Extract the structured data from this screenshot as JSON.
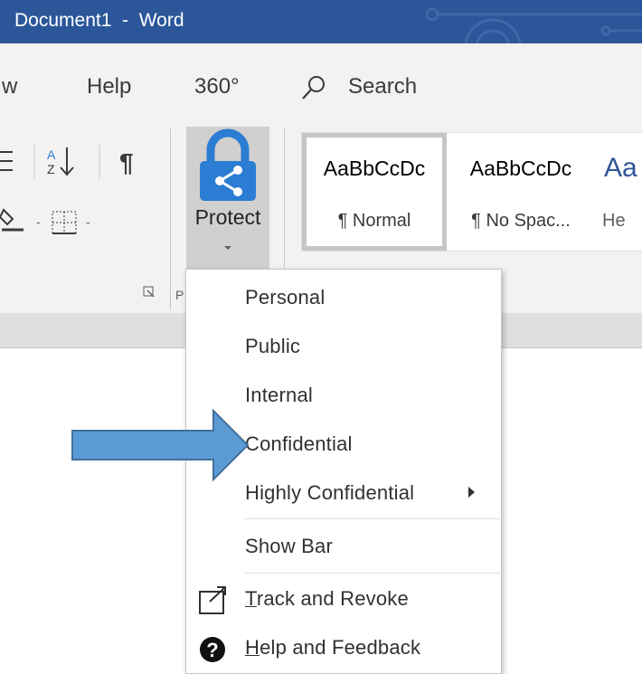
{
  "window": {
    "title": "Document1  -  Word"
  },
  "tabs": {
    "partial_tab": "w",
    "help": "Help",
    "three_sixty": "360°",
    "search_label": "Search"
  },
  "ribbon": {
    "protect_label": "Protect",
    "styles": [
      {
        "sample": "AaBbCcDc",
        "name": "¶ Normal"
      },
      {
        "sample": "AaBbCcDc",
        "name": "¶ No Spac..."
      },
      {
        "sample": "Aa",
        "name": "He"
      }
    ]
  },
  "protect_menu": {
    "items": [
      {
        "label": "Personal"
      },
      {
        "label": "Public"
      },
      {
        "label": "Internal"
      },
      {
        "label": "Confidential"
      },
      {
        "label": "Highly Confidential"
      },
      {
        "label": "Show Bar"
      },
      {
        "label": "Track and Revoke",
        "access_key": "T",
        "rest": "rack and Revoke"
      },
      {
        "label": "Help and Feedback",
        "access_key": "H",
        "rest": "elp and Feedback"
      }
    ]
  },
  "colors": {
    "title_bar": "#2b579a",
    "ribbon_bg": "#f3f2f1",
    "protect_icon": "#2b7cd3",
    "annotation_arrow": "#5b9bd5"
  },
  "icons": {
    "search": "search-icon",
    "protect": "lock-share-icon",
    "track": "track-revoke-icon",
    "help": "help-question-icon"
  }
}
